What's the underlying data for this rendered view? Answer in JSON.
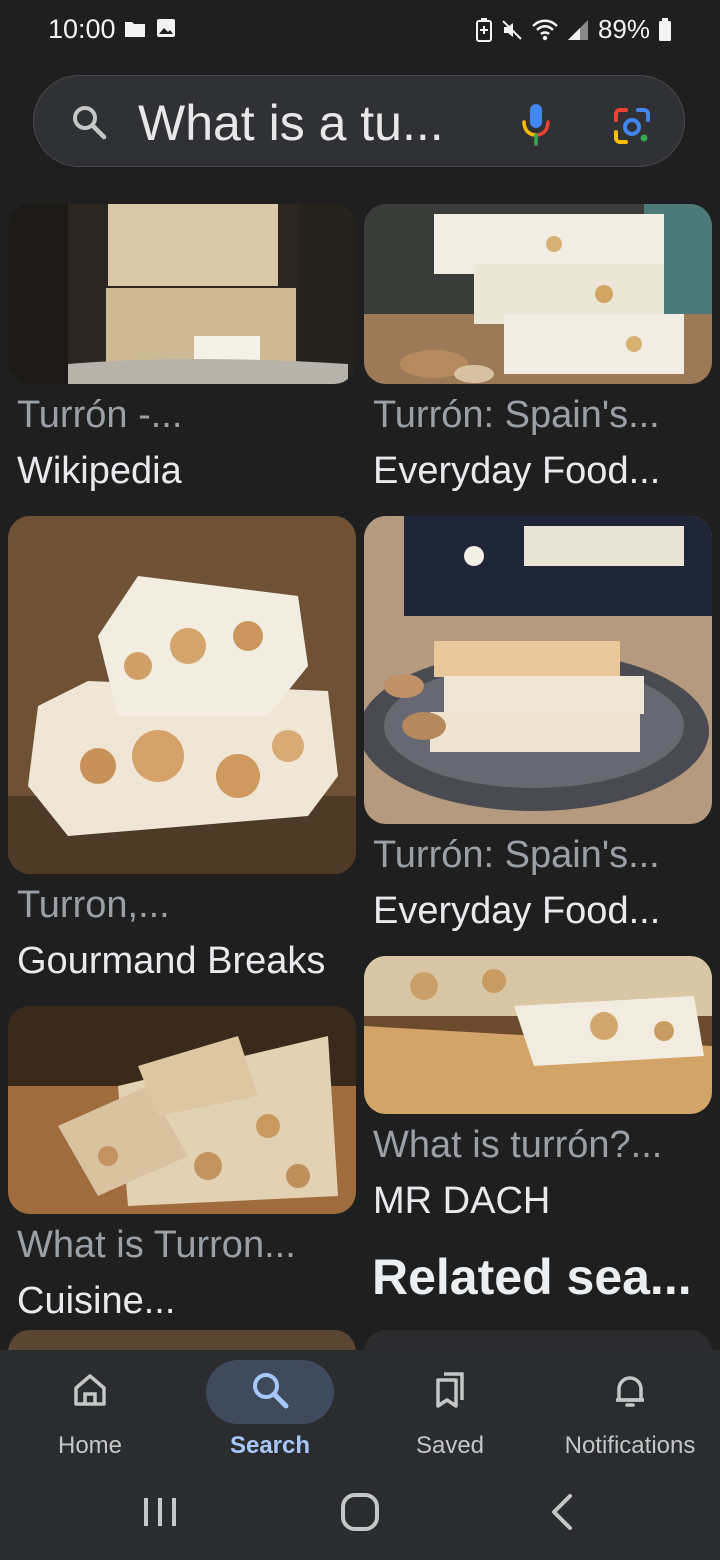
{
  "status_bar": {
    "time": "10:00",
    "battery": "89%"
  },
  "search": {
    "query": "What is a tu..."
  },
  "results": [
    {
      "title": "Turrón -...",
      "source": "Wikipedia"
    },
    {
      "title": "Turrón: Spain's...",
      "source": "Everyday Food..."
    },
    {
      "title": "Turron,...",
      "source": "Gourmand Breaks"
    },
    {
      "title": "Turrón: Spain's...",
      "source": "Everyday Food..."
    },
    {
      "title": "What is Turron...",
      "source": "Cuisine..."
    },
    {
      "title": "What is turrón?...",
      "source": "MR DACH"
    }
  ],
  "related_heading": "Related sea...",
  "nav": {
    "items": [
      {
        "label": "Home",
        "icon": "home-icon"
      },
      {
        "label": "Search",
        "icon": "search-icon"
      },
      {
        "label": "Saved",
        "icon": "saved-icon"
      },
      {
        "label": "Notifications",
        "icon": "bell-icon"
      }
    ],
    "active": "Search",
    "active_color": "#a8c7fa"
  }
}
